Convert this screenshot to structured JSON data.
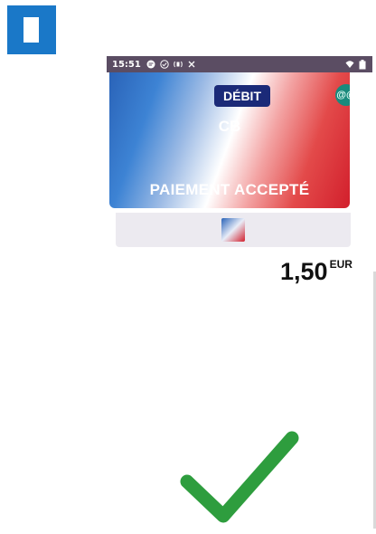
{
  "status_bar": {
    "time": "15:51",
    "icons": [
      "message-icon",
      "check-circle-icon",
      "nfc-icon",
      "signal-off-icon"
    ],
    "right_icons": [
      "wifi-icon",
      "battery-icon"
    ]
  },
  "card": {
    "type_badge": "DÉBIT",
    "network": "CB",
    "status": "PAIEMENT ACCEPTÉ",
    "contactless_symbol": "@@"
  },
  "amount": {
    "value": "1,50",
    "currency": "EUR"
  },
  "colors": {
    "logo_blue": "#1a78c8",
    "badge_navy": "#1b2a78",
    "check_green": "#2e9d3e"
  }
}
